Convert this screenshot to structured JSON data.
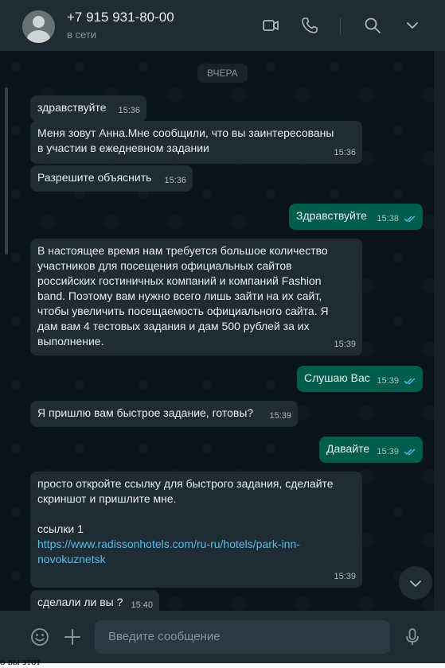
{
  "contact": {
    "name": "+7 915 931-80-00",
    "status": "в сети"
  },
  "header_icons": [
    "video-call-icon",
    "phone-icon",
    "search-icon",
    "chevron-down-icon"
  ],
  "date_chip": "ВЧЕРА",
  "messages": [
    {
      "dir": "in",
      "text": "здравствуйте",
      "time": "15:36"
    },
    {
      "dir": "in",
      "text": "Меня зовут Анна.Мне сообщили, что вы заинтересованы\nв участии в ежедневном задании",
      "time": "15:36"
    },
    {
      "dir": "in",
      "text": "Разрешите объяснить",
      "time": "15:36"
    },
    {
      "dir": "out",
      "text": "Здравствуйте",
      "time": "15:38"
    },
    {
      "dir": "in",
      "text": "В настоящее время нам требуется большое количество\nучастников для посещения официальных сайтов\nроссийских гостиничных компаний и компаний Fashion\nband. Поэтому вам нужно всего лишь зайти на их сайт,\nчтобы увеличить посещаемость официального сайта. Я\nдам вам 4 тестовых задания и дам 500 рублей за их\nвыполнение.",
      "time": "15:39"
    },
    {
      "dir": "out",
      "text": "Слушаю Вас",
      "time": "15:39"
    },
    {
      "dir": "in",
      "text": "Я пришлю вам быстрое задание, готовы?",
      "time": "15:39"
    },
    {
      "dir": "out",
      "text": "Давайте",
      "time": "15:39"
    },
    {
      "dir": "in",
      "text": "просто откройте ссылку для быстрого задания, сделайте\nскриншот и пришлите мне.\n\nссылки 1\n",
      "link": "https://www.radissonhotels.com/ru-ru/hotels/park-inn-\nnovokuznetsk",
      "time": "15:39"
    },
    {
      "dir": "in",
      "text": "сделали ли вы ?",
      "time": "15:40"
    }
  ],
  "composer": {
    "placeholder": "Введите сообщение"
  },
  "footer_icons": [
    "emoji-icon",
    "attach-plus-icon",
    "microphone-icon"
  ],
  "bottom_cut_text": "о вы этот",
  "colors": {
    "incoming": "#202c33",
    "outgoing": "#005c4b",
    "link": "#53bdeb",
    "ticks": "#53bdeb"
  }
}
